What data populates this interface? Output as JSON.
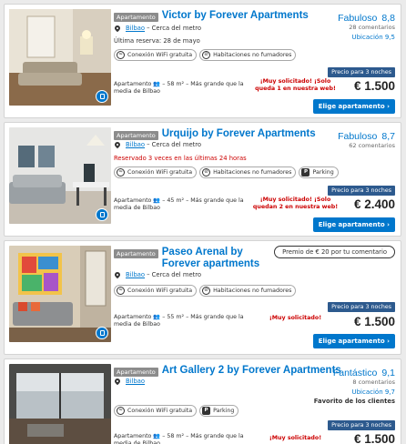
{
  "listings": [
    {
      "tag": "Apartamento",
      "name": "Victor by Forever Apartments",
      "city": "Bilbao",
      "location_note": "– Cerca del metro",
      "note": "Última reserva: 28 de mayo",
      "features": [
        "Conexión WiFi gratuita",
        "Habitaciones no fumadores"
      ],
      "info": "Apartamento 👥 – 58 m² – Más grande que la media de Bilbao",
      "urgent": "¡Muy solicitado! ¡Solo queda 1 en nuestra web!",
      "score_word": "Fabuloso",
      "score": "8,8",
      "reviews": "28 comentarios",
      "location_score": "Ubicación 9,5",
      "price_label": "Precio para 3 noches",
      "price": "€ 1.500",
      "cta": "Elige apartamento ›"
    },
    {
      "tag": "Apartamento",
      "name": "Urquijo by Forever Apartments",
      "city": "Bilbao",
      "location_note": "– Cerca del metro",
      "note": "Reservado 3 veces en las últimas 24 horas",
      "features": [
        "Conexión WiFi gratuita",
        "Habitaciones no fumadores",
        "Parking"
      ],
      "info": "Apartamento 👥 – 45 m² – Más grande que la media de Bilbao",
      "urgent": "¡Muy solicitado! ¡Solo quedan 2 en nuestra web!",
      "score_word": "Fabuloso",
      "score": "8,7",
      "reviews": "62 comentarios",
      "price_label": "Precio para 3 noches",
      "price": "€ 2.400",
      "cta": "Elige apartamento ›"
    },
    {
      "tag": "Apartamento",
      "name": "Paseo Arenal by Forever apartments",
      "city": "Bilbao",
      "location_note": "– Cerca del metro",
      "promo": "Premio de € 20 por tu comentario",
      "features": [
        "Conexión WiFi gratuita",
        "Habitaciones no fumadores"
      ],
      "info": "Apartamento 👥 – 55 m² – Más grande que la media de Bilbao",
      "urgent": "¡Muy solicitado!",
      "price_label": "Precio para 3 noches",
      "price": "€ 1.500",
      "cta": "Elige apartamento ›"
    },
    {
      "tag": "Apartamento",
      "name": "Art Gallery 2 by Forever Apartments",
      "city": "Bilbao",
      "features": [
        "Conexión WiFi gratuita",
        "Parking"
      ],
      "info": "Apartamento 👥 – 58 m² – Más grande que la media de Bilbao",
      "urgent": "¡Muy solicitado!",
      "score_word": "Fantástico",
      "score": "9,1",
      "reviews": "8 comentarios",
      "location_score": "Ubicación 9,7",
      "favorite": "Favorito de los clientes",
      "price_label": "Precio para 3 noches",
      "price": "€ 1.500"
    }
  ],
  "icons": {
    "wifi": "wifi-icon",
    "no_smoking": "no-smoking-icon",
    "parking": "parking-icon",
    "location": "pin-icon",
    "photo_badge": "photo-gallery-icon"
  },
  "colors": {
    "link": "#0077cc",
    "urgent": "#cc0000",
    "price_label_bg": "#2d5a8e"
  }
}
